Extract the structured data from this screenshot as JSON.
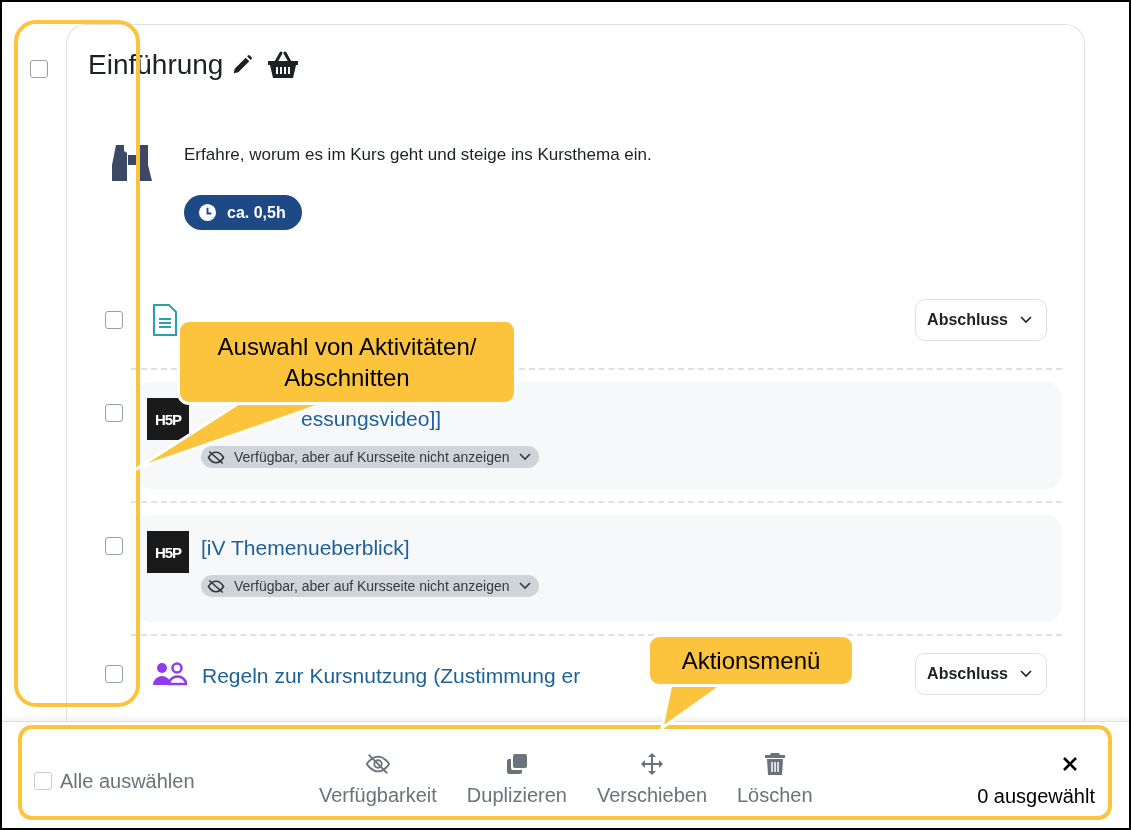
{
  "section": {
    "selected": false,
    "title": "Einführung",
    "description": "Erfahre, worum es im Kurs geht und steige ins Kursthema ein.",
    "duration": "ca. 0,5h"
  },
  "activities": [
    {
      "kind": "page",
      "selected": false,
      "completion": "Abschluss"
    },
    {
      "kind": "h5p",
      "selected": false,
      "logo": "H5P",
      "title": "essungsvideo]]",
      "availability": "Verfügbar, aber auf Kursseite nicht anzeigen"
    },
    {
      "kind": "h5p",
      "selected": false,
      "logo": "H5P",
      "title": "[iV Themenueberblick]",
      "availability": "Verfügbar, aber auf Kursseite nicht anzeigen"
    },
    {
      "kind": "group",
      "selected": false,
      "title": "Regeln zur Kursnutzung (Zustimmung er",
      "completion": "Abschluss"
    }
  ],
  "bulk_bar": {
    "select_all": {
      "label": "Alle auswählen",
      "checked": false
    },
    "actions": [
      {
        "kind": "availability",
        "label": "Verfügbarkeit"
      },
      {
        "kind": "duplicate",
        "label": "Duplizieren"
      },
      {
        "kind": "move",
        "label": "Verschieben"
      },
      {
        "kind": "delete",
        "label": "Löschen"
      }
    ],
    "count": "0 ausgewählt"
  },
  "annotations": [
    {
      "kind": "selection",
      "text": "Auswahl von Aktivitäten/ Abschnitten"
    },
    {
      "kind": "menu",
      "text": "Aktionsmenü"
    }
  ]
}
